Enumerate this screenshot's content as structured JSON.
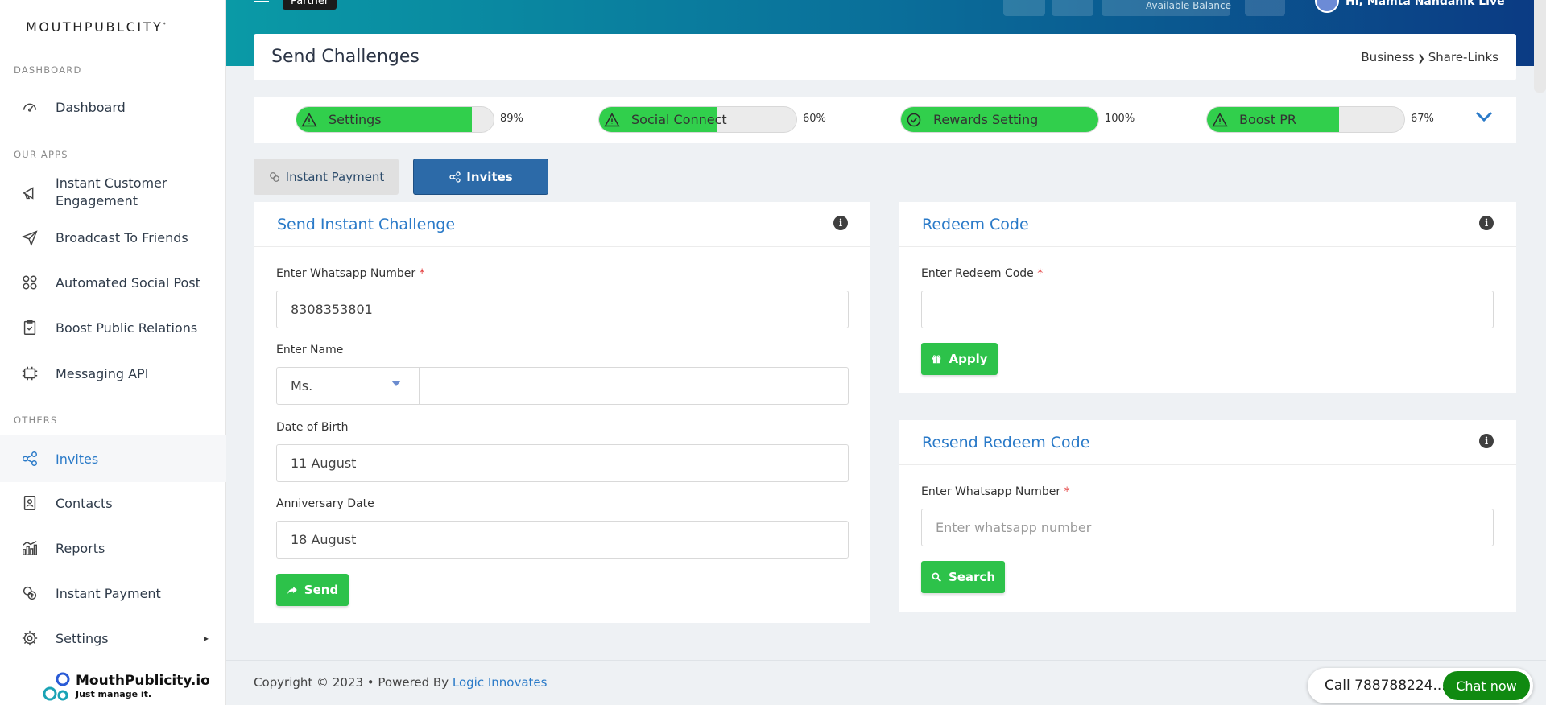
{
  "brand": {
    "name": "MOUTHPUBLCITY",
    "mark": "*"
  },
  "sidebar": {
    "sections": [
      {
        "label": "DASHBOARD"
      },
      {
        "label": "OUR APPS"
      },
      {
        "label": "OTHERS"
      }
    ],
    "items": [
      {
        "label": "Dashboard",
        "icon": "speedometer-icon"
      },
      {
        "label": "Instant Customer Engagement",
        "icon": "megaphone-icon"
      },
      {
        "label": "Broadcast To Friends",
        "icon": "send-icon"
      },
      {
        "label": "Automated Social Post",
        "icon": "apps-icon"
      },
      {
        "label": "Boost Public Relations",
        "icon": "clipboard-icon"
      },
      {
        "label": "Messaging API",
        "icon": "api-icon"
      },
      {
        "label": "Invites",
        "icon": "share-icon",
        "active": true
      },
      {
        "label": "Contacts",
        "icon": "contact-book-icon"
      },
      {
        "label": "Reports",
        "icon": "bar-chart-icon"
      },
      {
        "label": "Instant Payment",
        "icon": "payment-icon"
      },
      {
        "label": "Settings",
        "icon": "gear-icon"
      }
    ],
    "logo": {
      "line1": "MouthPublicity.io",
      "line2": "Just manage it."
    }
  },
  "topbar": {
    "partner_label": "Partner",
    "available_balance_label": "Available Balance",
    "greeting": "Hi, Mamta Nandanik Live"
  },
  "page": {
    "title": "Send Challenges",
    "breadcrumb": [
      "Business",
      "Share-Links"
    ]
  },
  "progress": [
    {
      "label": "Settings",
      "percent": 89,
      "pct_text": "89%",
      "status": "warning"
    },
    {
      "label": "Social Connect",
      "percent": 60,
      "pct_text": "60%",
      "status": "warning"
    },
    {
      "label": "Rewards Setting",
      "percent": 100,
      "pct_text": "100%",
      "status": "complete"
    },
    {
      "label": "Boost PR",
      "percent": 67,
      "pct_text": "67%",
      "status": "warning"
    }
  ],
  "tabs": [
    {
      "label": "Instant Payment",
      "active": false
    },
    {
      "label": "Invites",
      "active": true
    }
  ],
  "send_challenge": {
    "title": "Send Instant Challenge",
    "whatsapp_label": "Enter Whatsapp Number",
    "whatsapp_value": "8308353801",
    "name_label": "Enter Name",
    "salutation": "Ms.",
    "name_value": "",
    "dob_label": "Date of Birth",
    "dob_value": "11 August",
    "anniv_label": "Anniversary Date",
    "anniv_value": "18 August",
    "send_label": "Send"
  },
  "redeem": {
    "title": "Redeem Code",
    "code_label": "Enter Redeem Code",
    "code_value": "",
    "apply_label": "Apply"
  },
  "resend": {
    "title": "Resend Redeem Code",
    "whatsapp_label": "Enter Whatsapp Number",
    "whatsapp_placeholder": "Enter whatsapp number",
    "search_label": "Search"
  },
  "footer": {
    "copyright": "Copyright © 2023  • Powered By ",
    "link": "Logic Innovates"
  },
  "chat": {
    "call_text": "Call 788788224...",
    "chat_label": "Chat now"
  },
  "colors": {
    "accent": "#2a7ac8",
    "green": "#31cf4c",
    "tab_active": "#2c6aa8"
  }
}
